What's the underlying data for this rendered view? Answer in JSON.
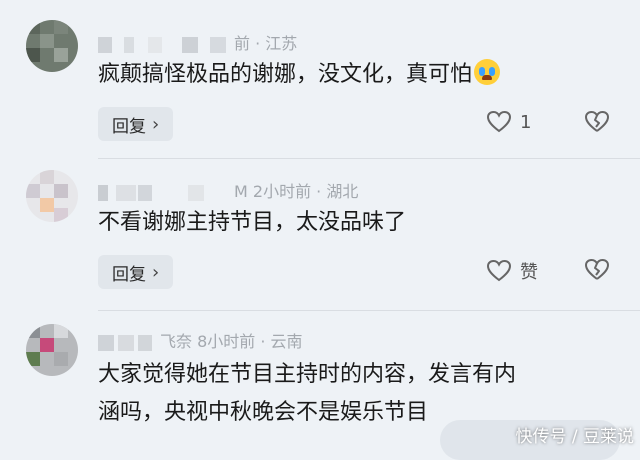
{
  "comments": [
    {
      "meta": "前 · 江苏",
      "text": "疯颠搞怪极品的谢娜，没文化，真可怕",
      "emoji_icon": "crying-face-icon",
      "reply_label": "回复",
      "like_count": "1"
    },
    {
      "meta": "M  2小时前 · 湖北",
      "text": "不看谢娜主持节目，太没品味了",
      "reply_label": "回复",
      "like_label": "赞"
    },
    {
      "meta": "飞奈  8小时前 · 云南",
      "text_line1": "大家觉得她在节目主持时的内容，发言有内",
      "text_line2": "涵吗，央视中秋晚会不是娱乐节目"
    }
  ],
  "watermark": "快传号 / 豆莱说",
  "colors": {
    "background": "#eef2f6",
    "meta": "#a3a8ae",
    "reply_bg": "#e1e6eb"
  }
}
